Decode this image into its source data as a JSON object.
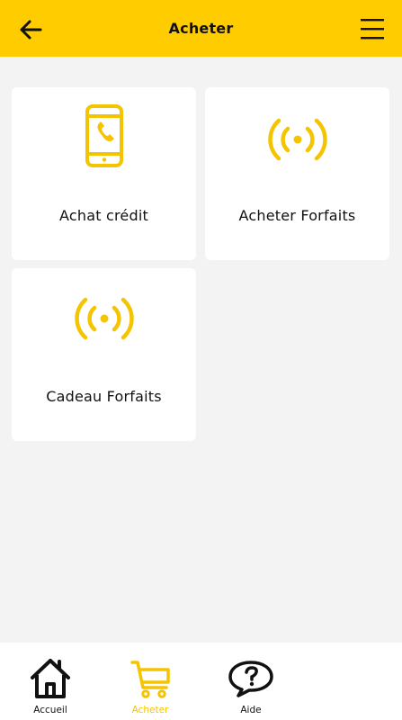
{
  "header": {
    "title": "Acheter",
    "back_icon": "arrow-left-icon",
    "menu_icon": "hamburger-menu-icon"
  },
  "cards": [
    {
      "label": "Achat crédit",
      "icon": "mobile-phone-icon"
    },
    {
      "label": "Acheter Forfaits",
      "icon": "signal-broadcast-icon"
    },
    {
      "label": "Cadeau Forfaits",
      "icon": "signal-broadcast-icon"
    }
  ],
  "nav": {
    "items": [
      {
        "label": "Accueil",
        "icon": "home-icon"
      },
      {
        "label": "Acheter",
        "icon": "cart-icon",
        "active": true
      },
      {
        "label": "Aide",
        "icon": "help-bubble-icon"
      }
    ]
  },
  "colors": {
    "brand_yellow": "#ffcc00",
    "accent_yellow": "#f5c400",
    "background": "#f3f3f3",
    "card": "#ffffff",
    "text": "#111111"
  }
}
